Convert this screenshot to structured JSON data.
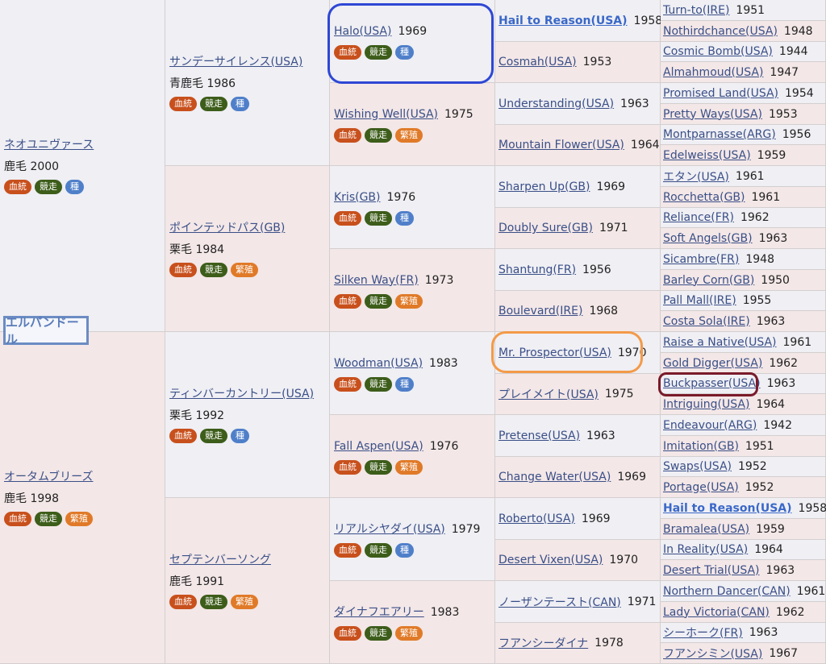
{
  "subject": "エルパンドール",
  "badge_labels": {
    "pedigree": "血統",
    "racing": "競走",
    "sire": "種",
    "broodmare": "繁殖"
  },
  "sire": {
    "name": "ネオユニヴァース",
    "detail": "鹿毛 2000",
    "badges": [
      "血統",
      "競走",
      "種"
    ]
  },
  "dam": {
    "name": "オータムブリーズ",
    "detail": "鹿毛 1998",
    "badges": [
      "血統",
      "競走",
      "繁殖"
    ]
  },
  "gen2": [
    {
      "name": "サンデーサイレンス(USA)",
      "detail": "青鹿毛 1986",
      "badges": [
        "血統",
        "競走",
        "種"
      ]
    },
    {
      "name": "ポインテッドパス(GB)",
      "detail": "栗毛 1984",
      "badges": [
        "血統",
        "競走",
        "繁殖"
      ]
    },
    {
      "name": "ティンバーカントリー(USA)",
      "detail": "栗毛 1992",
      "badges": [
        "血統",
        "競走",
        "種"
      ]
    },
    {
      "name": "セプテンバーソング",
      "detail": "鹿毛 1991",
      "badges": [
        "血統",
        "競走",
        "繁殖"
      ]
    }
  ],
  "gen3": [
    {
      "name": "Halo(USA)",
      "year": "1969",
      "badges": [
        "血統",
        "競走",
        "種"
      ]
    },
    {
      "name": "Wishing Well(USA)",
      "year": "1975",
      "badges": [
        "血統",
        "競走",
        "繁殖"
      ]
    },
    {
      "name": "Kris(GB)",
      "year": "1976",
      "badges": [
        "血統",
        "競走",
        "種"
      ]
    },
    {
      "name": "Silken Way(FR)",
      "year": "1973",
      "badges": [
        "血統",
        "競走",
        "繁殖"
      ]
    },
    {
      "name": "Woodman(USA)",
      "year": "1983",
      "badges": [
        "血統",
        "競走",
        "種"
      ]
    },
    {
      "name": "Fall Aspen(USA)",
      "year": "1976",
      "badges": [
        "血統",
        "競走",
        "繁殖"
      ]
    },
    {
      "name": "リアルシヤダイ(USA)",
      "year": "1979",
      "badges": [
        "血統",
        "競走",
        "種"
      ]
    },
    {
      "name": "ダイナフエアリー",
      "year": "1983",
      "badges": [
        "血統",
        "競走",
        "繁殖"
      ]
    }
  ],
  "gen4": [
    {
      "name": "Hail to Reason(USA)",
      "year": "1958",
      "bold": true
    },
    {
      "name": "Cosmah(USA)",
      "year": "1953"
    },
    {
      "name": "Understanding(USA)",
      "year": "1963"
    },
    {
      "name": "Mountain Flower(USA)",
      "year": "1964"
    },
    {
      "name": "Sharpen Up(GB)",
      "year": "1969"
    },
    {
      "name": "Doubly Sure(GB)",
      "year": "1971"
    },
    {
      "name": "Shantung(FR)",
      "year": "1956"
    },
    {
      "name": "Boulevard(IRE)",
      "year": "1968"
    },
    {
      "name": "Mr. Prospector(USA)",
      "year": "1970"
    },
    {
      "name": "プレイメイト(USA)",
      "year": "1975"
    },
    {
      "name": "Pretense(USA)",
      "year": "1963"
    },
    {
      "name": "Change Water(USA)",
      "year": "1969"
    },
    {
      "name": "Roberto(USA)",
      "year": "1969"
    },
    {
      "name": "Desert Vixen(USA)",
      "year": "1970"
    },
    {
      "name": "ノーザンテースト(CAN)",
      "year": "1971"
    },
    {
      "name": "フアンシーダイナ",
      "year": "1978"
    }
  ],
  "gen5": [
    {
      "name": "Turn-to(IRE)",
      "year": "1951"
    },
    {
      "name": "Nothirdchance(USA)",
      "year": "1948"
    },
    {
      "name": "Cosmic Bomb(USA)",
      "year": "1944"
    },
    {
      "name": "Almahmoud(USA)",
      "year": "1947"
    },
    {
      "name": "Promised Land(USA)",
      "year": "1954"
    },
    {
      "name": "Pretty Ways(USA)",
      "year": "1953"
    },
    {
      "name": "Montparnasse(ARG)",
      "year": "1956"
    },
    {
      "name": "Edelweiss(USA)",
      "year": "1959"
    },
    {
      "name": "エタン(USA)",
      "year": "1961"
    },
    {
      "name": "Rocchetta(GB)",
      "year": "1961"
    },
    {
      "name": "Reliance(FR)",
      "year": "1962"
    },
    {
      "name": "Soft Angels(GB)",
      "year": "1963"
    },
    {
      "name": "Sicambre(FR)",
      "year": "1948"
    },
    {
      "name": "Barley Corn(GB)",
      "year": "1950"
    },
    {
      "name": "Pall Mall(IRE)",
      "year": "1955"
    },
    {
      "name": "Costa Sola(IRE)",
      "year": "1963"
    },
    {
      "name": "Raise a Native(USA)",
      "year": "1961"
    },
    {
      "name": "Gold Digger(USA)",
      "year": "1962"
    },
    {
      "name": "Buckpasser(USA)",
      "year": "1963"
    },
    {
      "name": "Intriguing(USA)",
      "year": "1964"
    },
    {
      "name": "Endeavour(ARG)",
      "year": "1942"
    },
    {
      "name": "Imitation(GB)",
      "year": "1951"
    },
    {
      "name": "Swaps(USA)",
      "year": "1952"
    },
    {
      "name": "Portage(USA)",
      "year": "1952"
    },
    {
      "name": "Hail to Reason(USA)",
      "year": "1958",
      "bold": true
    },
    {
      "name": "Bramalea(USA)",
      "year": "1959"
    },
    {
      "name": "In Reality(USA)",
      "year": "1964"
    },
    {
      "name": "Desert Trial(USA)",
      "year": "1963"
    },
    {
      "name": "Northern Dancer(CAN)",
      "year": "1961"
    },
    {
      "name": "Lady Victoria(CAN)",
      "year": "1962"
    },
    {
      "name": "シーホーク(FR)",
      "year": "1963"
    },
    {
      "name": "フアンシミン(USA)",
      "year": "1967"
    }
  ],
  "colors": {
    "male_bg": "#efeff4",
    "female_bg": "#f3e7e7",
    "badge_pedigree": "#c8501c",
    "badge_racing": "#3d5d1a",
    "badge_sire": "#4f7fc9",
    "badge_broodmare": "#e07a28",
    "highlight_blue": "#2f47d4",
    "highlight_orange": "#f39a48",
    "highlight_maroon": "#7a1a2a"
  }
}
